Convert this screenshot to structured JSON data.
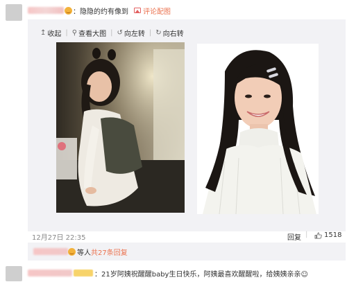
{
  "comment": {
    "text": "：隐隐的约有像到",
    "link_label": "评论配图"
  },
  "toolbar": {
    "items": [
      {
        "icon": "↥",
        "label": "收起"
      },
      {
        "icon": "⚲",
        "label": "查看大图"
      },
      {
        "icon": "↺",
        "label": "向左转"
      },
      {
        "icon": "↻",
        "label": "向右转"
      }
    ]
  },
  "meta": {
    "timestamp": "12月27日 22:35",
    "reply_label": "回复",
    "like_count": "1518"
  },
  "replies": {
    "static_text": "等人",
    "link_text": "共27条回复"
  },
  "next_comment": {
    "text": "：21岁阿姨祝醒醒baby生日快乐，阿姨最喜欢醒醒啦，给姨姨亲亲☺"
  },
  "colors": {
    "accent": "#eb7350",
    "panel_bg": "#f2f2f5"
  }
}
